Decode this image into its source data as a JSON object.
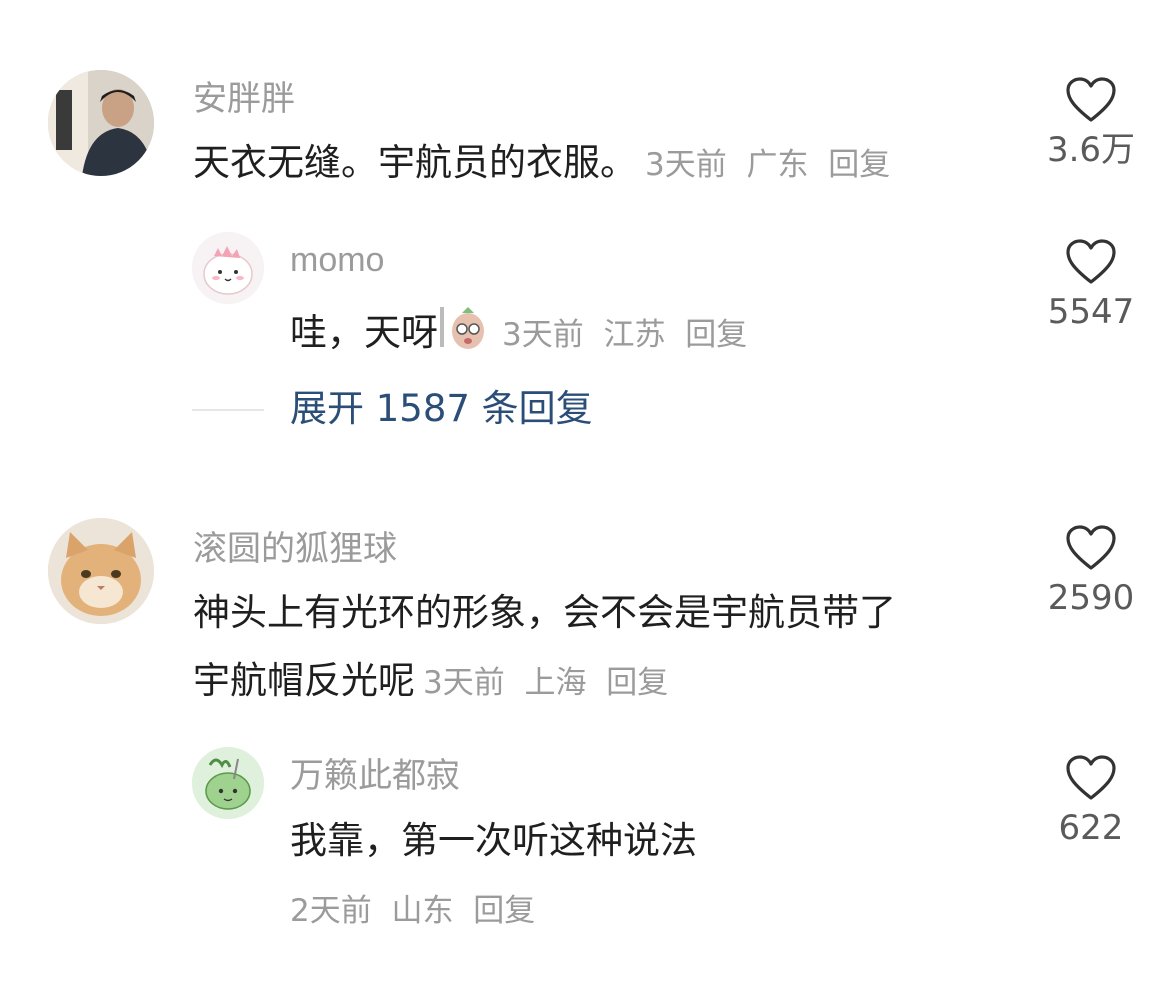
{
  "comments": [
    {
      "user": "安胖胖",
      "text": "天衣无缝。宇航员的衣服。",
      "time": "3天前",
      "location": "广东",
      "reply_label": "回复",
      "likes": "3.6万"
    },
    {
      "user": "momo",
      "text": "哇，天呀",
      "time": "3天前",
      "location": "江苏",
      "reply_label": "回复",
      "likes": "5547"
    },
    {
      "expand_label": "展开 1587 条回复"
    },
    {
      "user": "滚圆的狐狸球",
      "text_line1": "神头上有光环的形象，会不会是宇航员带了",
      "text_line2": "宇航帽反光呢",
      "time": "3天前",
      "location": "上海",
      "reply_label": "回复",
      "likes": "2590"
    },
    {
      "user": "万籁此都寂",
      "text": "我靠，第一次听这种说法",
      "time": "2天前",
      "location": "山东",
      "reply_label": "回复",
      "likes": "622"
    }
  ],
  "colors": {
    "username": "#9b9b9b",
    "body_text": "#1f1f1f",
    "meta": "#9b9b9b",
    "expand_link": "#2b4e78",
    "heart_stroke": "#333333"
  }
}
